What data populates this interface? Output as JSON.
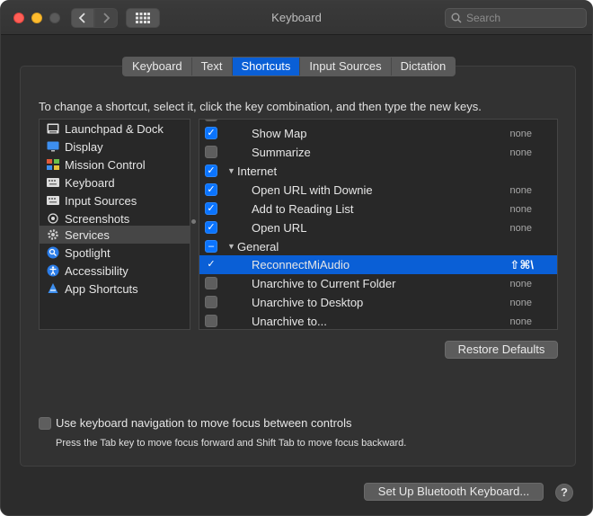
{
  "window": {
    "title": "Keyboard"
  },
  "search": {
    "placeholder": "Search"
  },
  "tabs": [
    {
      "label": "Keyboard"
    },
    {
      "label": "Text"
    },
    {
      "label": "Shortcuts",
      "active": true
    },
    {
      "label": "Input Sources"
    },
    {
      "label": "Dictation"
    }
  ],
  "instructions": "To change a shortcut, select it, click the key combination, and then type the new keys.",
  "categories": [
    {
      "label": "Launchpad & Dock",
      "icon": "launchpad-icon"
    },
    {
      "label": "Display",
      "icon": "display-icon"
    },
    {
      "label": "Mission Control",
      "icon": "mission-control-icon"
    },
    {
      "label": "Keyboard",
      "icon": "keyboard-icon"
    },
    {
      "label": "Input Sources",
      "icon": "input-sources-icon"
    },
    {
      "label": "Screenshots",
      "icon": "screenshots-icon"
    },
    {
      "label": "Services",
      "icon": "gear-icon",
      "selected": true
    },
    {
      "label": "Spotlight",
      "icon": "spotlight-icon"
    },
    {
      "label": "Accessibility",
      "icon": "accessibility-icon"
    },
    {
      "label": "App Shortcuts",
      "icon": "app-shortcuts-icon"
    }
  ],
  "shortcuts": [
    {
      "name": "Show Map",
      "kind": "item",
      "checked": true,
      "key": "none"
    },
    {
      "name": "Summarize",
      "kind": "item",
      "checked": false,
      "key": "none"
    },
    {
      "name": "Internet",
      "kind": "group",
      "checked": true,
      "key": ""
    },
    {
      "name": "Open URL with Downie",
      "kind": "item",
      "checked": true,
      "key": "none"
    },
    {
      "name": "Add to Reading List",
      "kind": "item",
      "checked": true,
      "key": "none"
    },
    {
      "name": "Open URL",
      "kind": "item",
      "checked": true,
      "key": "none"
    },
    {
      "name": "General",
      "kind": "group",
      "mixed": true,
      "key": ""
    },
    {
      "name": "ReconnectMiAudio",
      "kind": "item",
      "checked": true,
      "selected": true,
      "key": "⇧⌘\\"
    },
    {
      "name": "Unarchive to Current Folder",
      "kind": "item",
      "checked": false,
      "key": "none"
    },
    {
      "name": "Unarchive to Desktop",
      "kind": "item",
      "checked": false,
      "key": "none"
    },
    {
      "name": "Unarchive to...",
      "kind": "item",
      "checked": false,
      "key": "none"
    }
  ],
  "buttons": {
    "restore_defaults": "Restore Defaults",
    "bluetooth": "Set Up Bluetooth Keyboard...",
    "help": "?"
  },
  "keyboard_navigation": {
    "label": "Use keyboard navigation to move focus between controls",
    "checked": false,
    "hint": "Press the Tab key to move focus forward and Shift Tab to move focus backward."
  },
  "colors": {
    "accent": "#0a5fd6",
    "window_bg": "#2c2c2c",
    "checkbox_on": "#0a74ff"
  }
}
